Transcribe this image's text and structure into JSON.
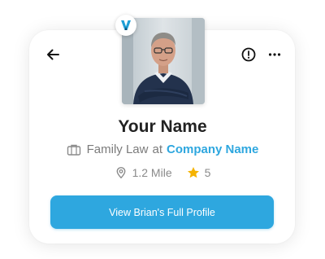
{
  "profile": {
    "name": "Your Name",
    "practice_area": "Family Law",
    "at_word": "at",
    "company": "Company Name",
    "distance": "1.2 Mile",
    "rating": "5"
  },
  "actions": {
    "view_profile_label": "View Brian's Full Profile"
  },
  "icons": {
    "back": "arrow-left-icon",
    "info": "info-circle-icon",
    "more": "more-horizontal-icon",
    "badge": "verified-v-logo",
    "briefcase": "briefcase-icon",
    "location": "location-pin-icon",
    "star": "star-icon"
  },
  "colors": {
    "accent": "#2ea7df",
    "star": "#f5b301",
    "text_dark": "#222222",
    "text_muted": "#7b7b7b"
  }
}
